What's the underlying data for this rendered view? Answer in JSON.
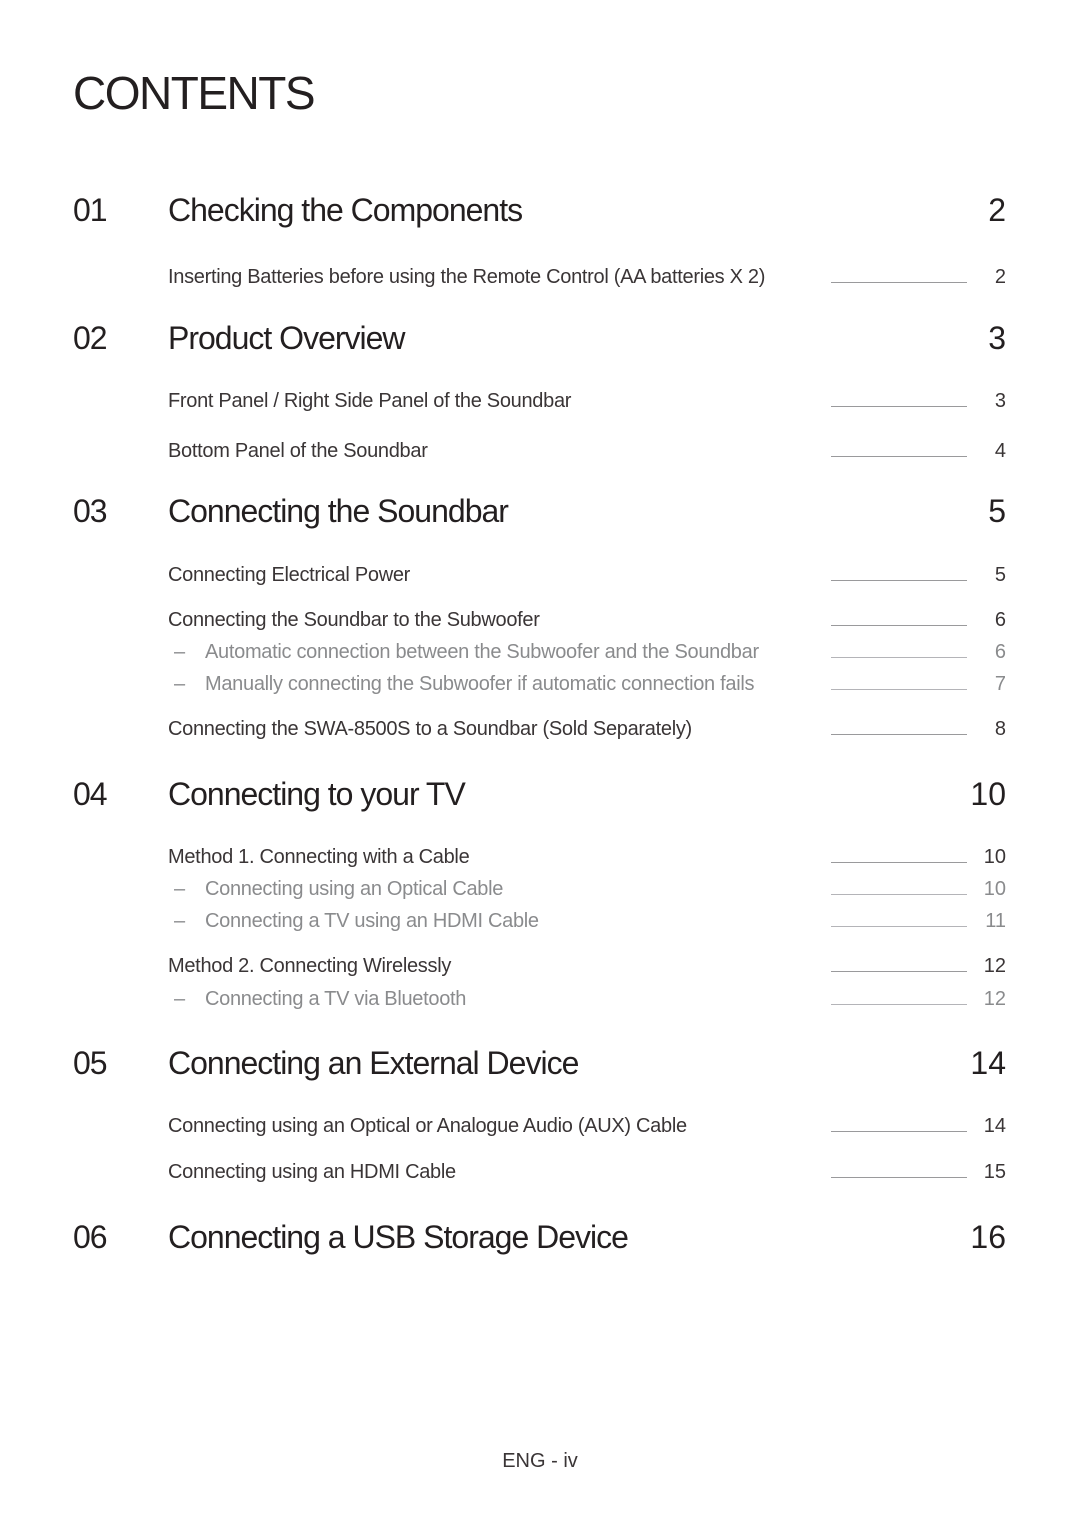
{
  "page_title": "CONTENTS",
  "chapters": [
    {
      "number": "01",
      "title": "Checking the Components",
      "page": "2",
      "entries": [
        {
          "text": "Inserting Batteries before using the Remote Control (AA batteries X 2)",
          "page": "2",
          "sub": false
        }
      ]
    },
    {
      "number": "02",
      "title": "Product Overview",
      "page": "3",
      "entries": [
        {
          "text": "Front Panel / Right Side Panel of the Soundbar",
          "page": "3",
          "sub": false
        },
        {
          "text": "Bottom Panel of the Soundbar",
          "page": "4",
          "sub": false
        }
      ]
    },
    {
      "number": "03",
      "title": "Connecting the Soundbar",
      "page": "5",
      "entries": [
        {
          "text": "Connecting Electrical Power",
          "page": "5",
          "sub": false
        },
        {
          "text": "Connecting the Soundbar to the Subwoofer",
          "page": "6",
          "sub": false
        },
        {
          "text": "Automatic connection between the Subwoofer and the Soundbar",
          "page": "6",
          "sub": true
        },
        {
          "text": "Manually connecting the Subwoofer if automatic connection fails",
          "page": "7",
          "sub": true
        },
        {
          "text": "Connecting the SWA-8500S to a Soundbar (Sold Separately)",
          "page": "8",
          "sub": false
        }
      ]
    },
    {
      "number": "04",
      "title": "Connecting to your TV",
      "page": "10",
      "entries": [
        {
          "text": "Method 1. Connecting with a Cable",
          "page": "10",
          "sub": false
        },
        {
          "text": "Connecting using an Optical Cable",
          "page": "10",
          "sub": true
        },
        {
          "text": "Connecting a TV using an HDMI Cable",
          "page": "11",
          "sub": true
        },
        {
          "text": "Method 2. Connecting Wirelessly",
          "page": "12",
          "sub": false
        },
        {
          "text": "Connecting a TV via Bluetooth",
          "page": "12",
          "sub": true
        }
      ]
    },
    {
      "number": "05",
      "title": "Connecting an External Device",
      "page": "14",
      "entries": [
        {
          "text": "Connecting using an Optical or Analogue Audio (AUX) Cable",
          "page": "14",
          "sub": false
        },
        {
          "text": "Connecting using an HDMI Cable",
          "page": "15",
          "sub": false
        }
      ]
    },
    {
      "number": "06",
      "title": "Connecting a USB Storage Device",
      "page": "16",
      "entries": []
    }
  ],
  "dash_glyph": "–",
  "footer": "ENG - iv"
}
